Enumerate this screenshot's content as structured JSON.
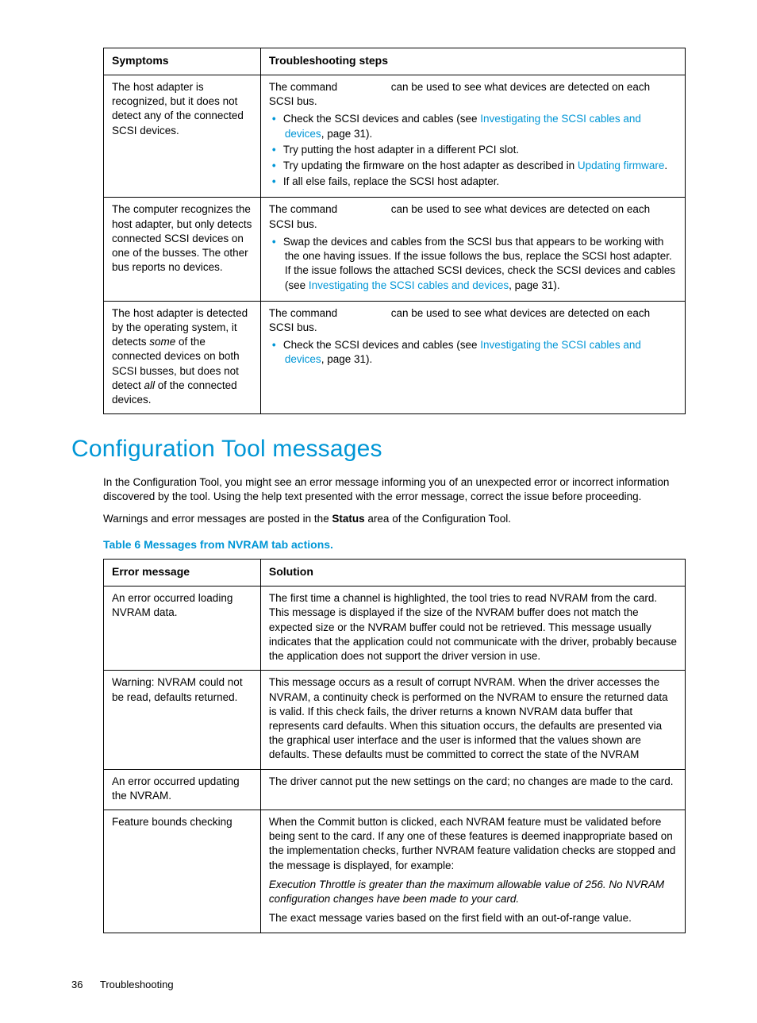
{
  "table1": {
    "headers": [
      "Symptoms",
      "Troubleshooting steps"
    ],
    "rows": [
      {
        "symptom": "The host adapter is recognized, but it does not detect any of the connected SCSI devices.",
        "lead_a": "The command ",
        "lead_b": " can be used to see what devices are detected on each SCSI bus.",
        "b1a": "Check the SCSI devices and cables (see ",
        "b1link": "Investigating the SCSI cables and devices",
        "b1b": ", page 31).",
        "b2": "Try putting the host adapter in a different PCI slot.",
        "b3a": "Try updating the firmware on the host adapter as described in ",
        "b3link": "Updating firmware",
        "b3b": ".",
        "b4": "If all else fails, replace the SCSI host adapter."
      },
      {
        "symptom": "The computer recognizes the host adapter, but only detects connected SCSI devices on one of the busses. The other bus reports no devices.",
        "lead_a": "The command ",
        "lead_b": " can be used to see what devices are detected on each SCSI bus.",
        "b1a": "Swap the devices and cables from the SCSI bus that appears to be working with the one having issues. If the issue follows the bus, replace the SCSI host adapter. If the issue follows the attached SCSI devices, check the SCSI devices and cables (see ",
        "b1link": "Investigating the SCSI cables and devices",
        "b1b": ", page 31)."
      },
      {
        "sym_a": "The host adapter is detected by the operating system, it detects ",
        "sym_i1": "some",
        "sym_b": " of the connected devices on both SCSI busses, but does not detect ",
        "sym_i2": "all",
        "sym_c": " of the connected devices.",
        "lead_a": "The command ",
        "lead_b": " can be used to see what devices are detected on each SCSI bus.",
        "b1a": "Check the SCSI devices and cables (see ",
        "b1link": "Investigating the SCSI cables and devices",
        "b1b": ", page 31)."
      }
    ]
  },
  "section_heading": "Configuration Tool messages",
  "para1": "In the Configuration Tool, you might see an error message informing you of an unexpected error or incorrect information discovered by the tool. Using the help text presented with the error message, correct the issue before proceeding.",
  "para2a": "Warnings and error messages are posted in the ",
  "para2b": "Status",
  "para2c": " area of the Configuration Tool.",
  "table2_caption": "Table 6 Messages from NVRAM tab actions.",
  "table2": {
    "headers": [
      "Error message",
      "Solution"
    ],
    "rows": [
      {
        "err": "An error occurred loading NVRAM data.",
        "sol": "The first time a channel is highlighted, the tool tries to read NVRAM from the card. This message is displayed if the size of the NVRAM buffer does not match the expected size or the NVRAM buffer could not be retrieved. This message usually indicates that the application could not communicate with the driver, probably because the application does not support the driver version in use."
      },
      {
        "err": "Warning: NVRAM could not be read, defaults returned.",
        "sol": "This message occurs as a result of corrupt NVRAM. When the driver accesses the NVRAM, a continuity check is performed on the NVRAM to ensure the returned data is valid. If this check fails, the driver returns a known NVRAM data buffer that represents card defaults. When this situation occurs, the defaults are presented via the graphical user interface and the user is informed that the values shown are defaults. These defaults must be committed to correct the state of the NVRAM"
      },
      {
        "err": "An error occurred updating the NVRAM.",
        "sol": "The driver cannot put the new settings on the card; no changes are made to the card."
      },
      {
        "err": "Feature bounds checking",
        "sol_a": "When the Commit button is clicked, each NVRAM feature must be validated before being sent to the card. If any one of these features is deemed inappropriate based on the implementation checks, further NVRAM feature validation checks are stopped and the message is displayed, for example:",
        "sol_i": "Execution Throttle is greater than the maximum allowable value of 256. No NVRAM configuration changes have been made to your card.",
        "sol_b": "The exact message varies based on the first field with an out-of-range value."
      }
    ]
  },
  "footer": {
    "page": "36",
    "title": "Troubleshooting"
  }
}
